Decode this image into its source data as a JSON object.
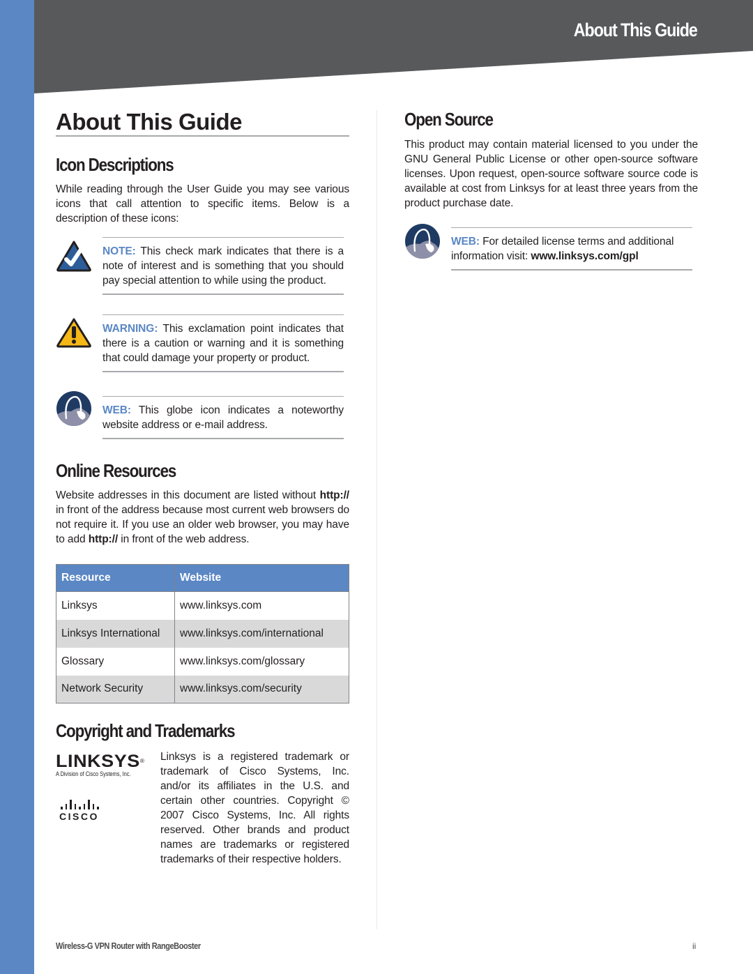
{
  "header": {
    "running_title": "About This Guide"
  },
  "page_title": "About This Guide",
  "icon_descriptions": {
    "heading": "Icon Descriptions",
    "intro": "While reading through the User Guide you may see various icons that call attention to specific items. Below is a description of these icons:",
    "callouts": [
      {
        "icon": "checkmark-note-icon",
        "label": "NOTE:",
        "text": " This check mark indicates that there is a note of interest and is something that you should pay special attention to while using the product."
      },
      {
        "icon": "exclamation-warning-icon",
        "label": "WARNING:",
        "text": " This exclamation point indicates that there is a caution or warning and it is something that could damage your property or product."
      },
      {
        "icon": "globe-web-icon",
        "label": "WEB:",
        "text": " This globe icon indicates a noteworthy website address or e-mail address."
      }
    ]
  },
  "online_resources": {
    "heading": "Online Resources",
    "para_part1": "Website addresses in this document are listed without ",
    "para_bold1": "http://",
    "para_part2": " in front of the address because most current web browsers do not require it. If you use an older web browser, you may have to add ",
    "para_bold2": "http://",
    "para_part3": " in front of the web address.",
    "table": {
      "headers": [
        "Resource",
        "Website"
      ],
      "rows": [
        [
          "Linksys",
          "www.linksys.com"
        ],
        [
          "Linksys International",
          "www.linksys.com/international"
        ],
        [
          "Glossary",
          "www.linksys.com/glossary"
        ],
        [
          "Network Security",
          "www.linksys.com/security"
        ]
      ]
    }
  },
  "copyright": {
    "heading": "Copyright and Trademarks",
    "linksys_logo_text": "LINKSYS",
    "linksys_reg_mark": "®",
    "linksys_tagline": "A Division of Cisco Systems, Inc.",
    "cisco_logo_text": "CISCO",
    "text": "Linksys is a registered trademark or trademark of Cisco Systems, Inc. and/or its affiliates in the U.S. and certain other countries. Copyright © 2007 Cisco Systems, Inc. All rights reserved. Other brands and product names are trademarks or registered trademarks of their respective holders."
  },
  "open_source": {
    "heading": "Open Source",
    "text": "This product may contain material licensed to you under the GNU General Public License or other open-source software licenses. Upon request, open-source software source code is available at cost from Linksys for at least three years from the product purchase date.",
    "web_callout": {
      "icon": "globe-web-icon",
      "label": "WEB:",
      "text": " For detailed license terms and additional information visit: ",
      "link": "www.linksys.com/gpl"
    }
  },
  "footer": {
    "product_name": "Wireless-G VPN Router with RangeBooster",
    "page_number": "ii"
  },
  "colors": {
    "accent_blue": "#5b87c5",
    "header_gray": "#58595b",
    "warning_yellow": "#f6b817",
    "note_blue": "#2d5c9a",
    "globe_navy": "#1f3b63"
  }
}
